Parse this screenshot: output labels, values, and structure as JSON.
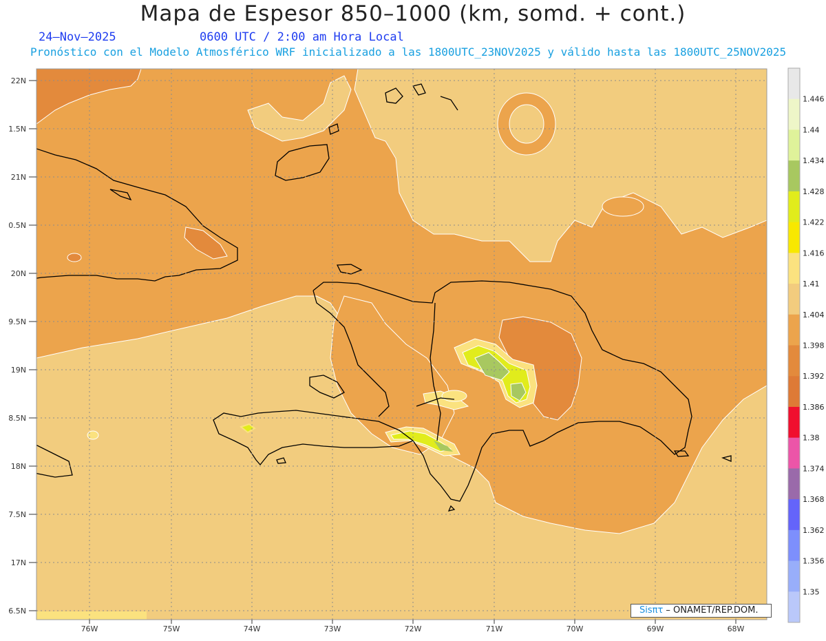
{
  "header": {
    "title": "Mapa de Espesor 850–1000 (km, somd. + cont.)",
    "date": "24–Nov–2025",
    "valid_time": "0600 UTC / 2:00 am Hora Local",
    "run_info": "Pronóstico con el Modelo Atmosférico WRF inicializado a las 1800UTC_23NOV2025 y válido hasta las  1800UTC_25NOV2025"
  },
  "map": {
    "lat_labels": [
      "22N",
      "1.5N",
      "21N",
      "0.5N",
      "20N",
      "9.5N",
      "19N",
      "8.5N",
      "18N",
      "7.5N",
      "17N",
      "6.5N"
    ],
    "lon_labels": [
      "76W",
      "75W",
      "74W",
      "73W",
      "72W",
      "71W",
      "70W",
      "69W",
      "68W"
    ],
    "fill_colors": {
      "c1392": "#e38a3c",
      "c1398": "#eca44c",
      "c1404": "#f2cc7e",
      "c1410": "#fbe27f",
      "c1416": "#f8e800",
      "c1428": "#e1ec1c",
      "c1434": "#a8c860"
    }
  },
  "legend": {
    "labels": [
      "1.446",
      "1.44",
      "1.434",
      "1.428",
      "1.422",
      "1.416",
      "1.41",
      "1.404",
      "1.398",
      "1.392",
      "1.386",
      "1.38",
      "1.374",
      "1.368",
      "1.362",
      "1.356",
      "1.35"
    ],
    "colors": [
      "#e8e8e8",
      "#eef6c8",
      "#dff29a",
      "#a8c860",
      "#e1ec1c",
      "#f8e800",
      "#fbe27f",
      "#f2cc7e",
      "#eca44c",
      "#e38a3c",
      "#de7a36",
      "#f00f2e",
      "#ec55a8",
      "#9a6aaa",
      "#6464fa",
      "#7d8ffc",
      "#98aefa",
      "#bac8fa"
    ]
  },
  "credit": {
    "sis": "Sisπτ",
    "org": " – ONAMET/REP.DOM."
  }
}
